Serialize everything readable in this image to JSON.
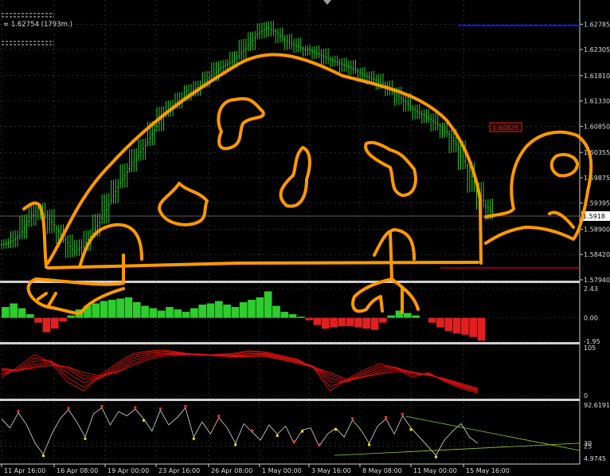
{
  "header": {
    "quote": "= 1.62754 (1793m.)"
  },
  "colors": {
    "background": "#000000",
    "grid": "#4a4a4a",
    "up_candle": "#2ecc2e",
    "histogram_up": "#2ecc2e",
    "histogram_down": "#e02020",
    "ribbon": "#e01010",
    "oscillator_line": "#dcdcdc",
    "drawing": "#ff9900",
    "price_line": "#0000ff",
    "stop_line": "#cc0000",
    "current_price_box": "#ffffff"
  },
  "chart_data": [
    {
      "type": "line",
      "name": "price-panel",
      "y_ticks": [
        "1.62785",
        "1.62305",
        "1.61810",
        "1.61330",
        "1.60850",
        "1.60355",
        "1.59875",
        "1.59395",
        "1.58900",
        "1.58420",
        "1.57940"
      ],
      "ylim": [
        1.5794,
        1.6279
      ],
      "x_ticks": [
        "11 Apr 16:00",
        "16 Apr 08:00",
        "19 Apr 00:00",
        "23 Apr 16:00",
        "26 Apr 08:00",
        "1 May 00:00",
        "3 May 16:00",
        "8 May 08:00",
        "11 May 00:00",
        "15 May 16:00"
      ],
      "current_price_label": "1.5918",
      "pending_label": "1.60825",
      "close_series": [
        1.5865,
        1.5878,
        1.5905,
        1.593,
        1.5915,
        1.5892,
        1.587,
        1.5846,
        1.5858,
        1.5882,
        1.591,
        1.5945,
        1.5978,
        1.6005,
        1.603,
        1.6055,
        1.6085,
        1.611,
        1.6128,
        1.614,
        1.6152,
        1.6165,
        1.618,
        1.6195,
        1.6205,
        1.6218,
        1.6238,
        1.6258,
        1.6272,
        1.6265,
        1.625,
        1.624,
        1.6232,
        1.6228,
        1.622,
        1.6212,
        1.6205,
        1.6198,
        1.619,
        1.618,
        1.6172,
        1.6165,
        1.615,
        1.6135,
        1.612,
        1.6108,
        1.6098,
        1.6086,
        1.607,
        1.6045,
        1.601,
        1.597,
        1.5935,
        1.5918
      ]
    },
    {
      "type": "bar",
      "name": "histogram-panel",
      "y_ticks": [
        "2.43",
        "0.00",
        "-1.95"
      ],
      "ylim": [
        -1.95,
        2.43
      ],
      "values": [
        0.9,
        1.2,
        0.8,
        0.3,
        -0.4,
        -1.2,
        -0.9,
        -0.3,
        0.2,
        0.7,
        1.0,
        1.2,
        1.4,
        1.5,
        1.6,
        1.7,
        1.3,
        1.0,
        0.8,
        0.6,
        0.9,
        0.7,
        0.5,
        0.8,
        1.1,
        1.2,
        1.4,
        1.1,
        0.9,
        1.3,
        1.5,
        1.7,
        2.2,
        1.0,
        0.5,
        0.3,
        0.1,
        -0.2,
        -0.6,
        -0.9,
        -0.8,
        -0.7,
        -0.7,
        -0.8,
        -0.9,
        -1.0,
        -0.4,
        0.2,
        0.6,
        0.4,
        0.2,
        0.0,
        -0.4,
        -0.8,
        -1.1,
        -1.3,
        -1.4,
        -1.6,
        -1.9
      ]
    },
    {
      "type": "line",
      "name": "ribbon-panel",
      "y_ticks": [
        "105",
        "0"
      ],
      "ylim": [
        0,
        105
      ],
      "series": [
        {
          "values": [
            40,
            62,
            90,
            72,
            30,
            10,
            45,
            70,
            92,
            98,
            100,
            94,
            88,
            90,
            92,
            98,
            96,
            88,
            80,
            60,
            10,
            35,
            55,
            70,
            60,
            40,
            50,
            30,
            15,
            5
          ]
        },
        {
          "values": [
            45,
            58,
            82,
            75,
            40,
            18,
            40,
            65,
            88,
            95,
            97,
            93,
            90,
            89,
            90,
            95,
            94,
            86,
            78,
            62,
            20,
            32,
            50,
            65,
            62,
            45,
            48,
            32,
            18,
            8
          ]
        },
        {
          "values": [
            50,
            55,
            75,
            76,
            50,
            28,
            38,
            60,
            82,
            92,
            95,
            92,
            91,
            88,
            88,
            92,
            92,
            84,
            76,
            64,
            30,
            30,
            46,
            60,
            62,
            50,
            46,
            34,
            20,
            10
          ]
        },
        {
          "values": [
            55,
            54,
            68,
            74,
            58,
            36,
            38,
            56,
            76,
            88,
            92,
            91,
            91,
            88,
            87,
            89,
            90,
            82,
            74,
            64,
            38,
            30,
            42,
            55,
            60,
            52,
            45,
            36,
            22,
            12
          ]
        },
        {
          "values": [
            58,
            54,
            63,
            70,
            62,
            44,
            40,
            52,
            70,
            84,
            90,
            90,
            90,
            88,
            86,
            87,
            88,
            80,
            72,
            63,
            45,
            32,
            40,
            50,
            56,
            52,
            45,
            37,
            24,
            14
          ]
        },
        {
          "values": [
            60,
            55,
            60,
            66,
            63,
            50,
            44,
            50,
            66,
            80,
            87,
            89,
            89,
            87,
            85,
            85,
            86,
            79,
            71,
            62,
            50,
            36,
            40,
            47,
            52,
            50,
            44,
            37,
            26,
            16
          ]
        }
      ]
    },
    {
      "type": "line",
      "name": "oscillator-panel",
      "y_ticks": [
        "92.6191",
        "30",
        "25",
        "4.9745"
      ],
      "ylim": [
        4.9745,
        92.6191
      ],
      "values": [
        70,
        55,
        80,
        60,
        30,
        12,
        45,
        70,
        85,
        65,
        40,
        78,
        88,
        60,
        82,
        75,
        86,
        70,
        50,
        84,
        60,
        72,
        88,
        40,
        65,
        45,
        72,
        55,
        30,
        62,
        48,
        35,
        60,
        45,
        58,
        30,
        52,
        55,
        25,
        45,
        55,
        40,
        68,
        52,
        30,
        58,
        70,
        45,
        75,
        55,
        40,
        25,
        10,
        35,
        50,
        62,
        40,
        30
      ],
      "up_markers": [
        2,
        8,
        12,
        16,
        19,
        22,
        26,
        30,
        35,
        38,
        42,
        46,
        48
      ],
      "down_markers": [
        5,
        10,
        17,
        23,
        28,
        33,
        36,
        40,
        44,
        49,
        52
      ],
      "trend_upper": [
        74,
        18
      ],
      "trend_lower": [
        10,
        30
      ]
    }
  ]
}
